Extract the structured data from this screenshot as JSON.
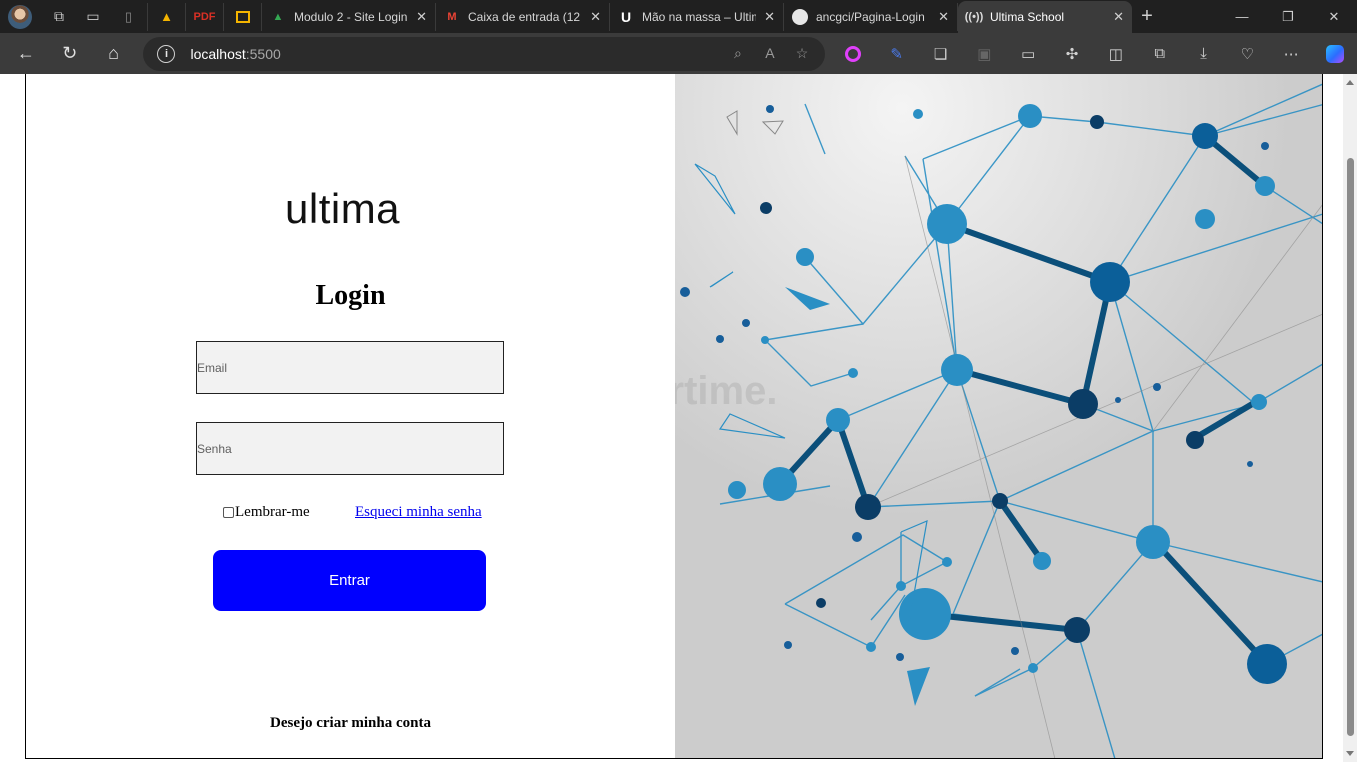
{
  "browser": {
    "tabs": [
      {
        "title": "Modulo 2 - Site Login",
        "icon": "google-drive-icon"
      },
      {
        "title": "Caixa de entrada (12",
        "icon": "gmail-icon"
      },
      {
        "title": "Mão na massa – Ultim",
        "icon": "ultima-icon"
      },
      {
        "title": "ancgci/Pagina-Login",
        "icon": "github-icon"
      },
      {
        "title": "Ultima School",
        "icon": "live-server-icon",
        "active": true
      }
    ],
    "address": {
      "host": "localhost",
      "port": ":5500"
    }
  },
  "page": {
    "logo_text": "ultima",
    "title": "Login",
    "email_placeholder": "Email",
    "password_placeholder": "Senha",
    "remember_label": "Lembrar-me",
    "forgot_link": "Esqueci minha senha",
    "submit_label": "Entrar",
    "signup_text": "Desejo criar minha conta",
    "watermark": "rtime."
  },
  "colors": {
    "accent": "#0000ff",
    "art_bg": "#cfcfcf",
    "node_blue": "#2a8fc4",
    "node_dark": "#0b4f7a"
  }
}
